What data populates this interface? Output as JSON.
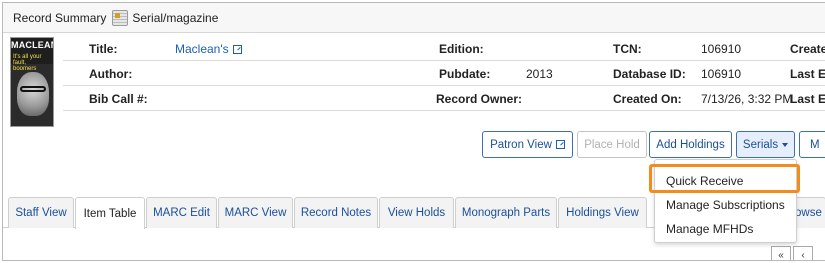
{
  "summary": {
    "title": "Record Summary",
    "format_icon": "serial-format-icon",
    "format": "Serial/magazine"
  },
  "cover": {
    "masthead": "MACLEAN'S",
    "tagline": "It's all your fault, boomers"
  },
  "record": {
    "rows": [
      [
        {
          "label": "Title:",
          "value": "Maclean's",
          "link": true
        },
        {
          "label": "Edition:",
          "value": ""
        },
        {
          "label": "TCN:",
          "value": "106910"
        },
        {
          "label": "Create",
          "value": ""
        }
      ],
      [
        {
          "label": "Author:",
          "value": ""
        },
        {
          "label": "Pubdate:",
          "value": "2013"
        },
        {
          "label": "Database ID:",
          "value": "106910"
        },
        {
          "label": "Last E",
          "value": ""
        }
      ],
      [
        {
          "label": "Bib Call #:",
          "value": ""
        },
        {
          "label": "Record Owner:",
          "value": ""
        },
        {
          "label": "Created On:",
          "value": "7/13/26, 3:32 PM"
        },
        {
          "label": "Last E",
          "value": ""
        }
      ]
    ]
  },
  "actions": {
    "patron_view": "Patron View",
    "place_hold": "Place Hold",
    "add_holdings": "Add Holdings",
    "serials": "Serials",
    "more": "M"
  },
  "tabs": [
    "Staff View",
    "Item Table",
    "MARC Edit",
    "MARC View",
    "Record Notes",
    "View Holds",
    "Monograph Parts",
    "Holdings View",
    "owse"
  ],
  "serials_menu": [
    "Quick Receive",
    "Manage Subscriptions",
    "Manage MFHDs"
  ],
  "pager": [
    "«",
    "‹"
  ],
  "colors": {
    "accent": "#1a4f99",
    "highlight": "#f28c1d"
  }
}
